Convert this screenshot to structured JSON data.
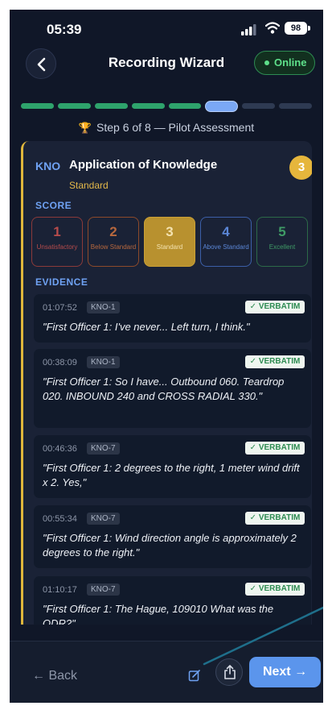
{
  "status_bar": {
    "time": "05:39",
    "battery": "98"
  },
  "header": {
    "title": "Recording Wizard",
    "status": "Online"
  },
  "progress": {
    "total_steps": 8,
    "current_step": 6
  },
  "step_label": "Step 6 of 8 — Pilot Assessment",
  "competency": {
    "code": "KNO",
    "title": "Application of Knowledge",
    "subtitle": "Standard",
    "score": "3"
  },
  "score_section": {
    "label": "SCORE",
    "options": [
      {
        "num": "1",
        "label": "Unsatisfactory"
      },
      {
        "num": "2",
        "label": "Below Standard"
      },
      {
        "num": "3",
        "label": "Standard"
      },
      {
        "num": "4",
        "label": "Above Standard"
      },
      {
        "num": "5",
        "label": "Excellent"
      }
    ],
    "selected": "3"
  },
  "evidence_section": {
    "label": "EVIDENCE",
    "items": [
      {
        "timestamp": "01:07:52",
        "tag": "KNO-1",
        "badge": "✓ VERBATIM",
        "quote": "\"First Officer 1: I've never... Left turn, I think.\""
      },
      {
        "timestamp": "00:38:09",
        "tag": "KNO-1",
        "badge": "✓ VERBATIM",
        "quote": "\"First Officer 1: So I have... Outbound 060. Teardrop 020. INBOUND 240 and CROSS RADIAL 330.\""
      },
      {
        "timestamp": "00:46:36",
        "tag": "KNO-7",
        "badge": "✓ VERBATIM",
        "quote": "\"First Officer 1: 2 degrees to the right, 1 meter wind drift x 2. Yes,\""
      },
      {
        "timestamp": "00:55:34",
        "tag": "KNO-7",
        "badge": "✓ VERBATIM",
        "quote": "\"First Officer 1: Wind direction angle is approximately 2 degrees to the right.\""
      },
      {
        "timestamp": "01:10:17",
        "tag": "KNO-7",
        "badge": "✓ VERBATIM",
        "quote": "\"First Officer 1: The Hague, 109010 What was the QDR?\""
      }
    ]
  },
  "footer": {
    "back_label": "← Back",
    "next_label": "Next →"
  },
  "colors": {
    "background": "#101728",
    "accent": "#5b95ec",
    "gold": "#e6b63c",
    "success": "#2ea36c"
  }
}
